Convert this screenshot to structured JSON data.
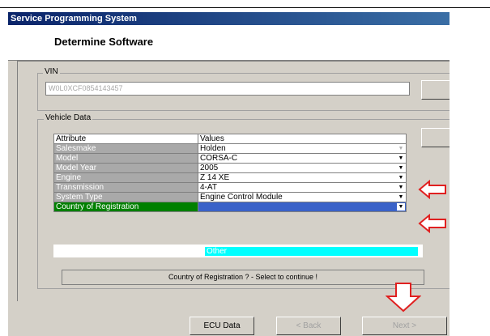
{
  "window": {
    "title": "Service Programming System"
  },
  "header": {
    "title": "Determine Software"
  },
  "vin": {
    "label": "VIN",
    "value": "W0L0XCF0854143457"
  },
  "vehicle_data": {
    "label": "Vehicle Data",
    "columns": [
      "Attribute",
      "Values"
    ],
    "rows": [
      {
        "attribute": "Salesmake",
        "value": "Holden",
        "dropdown_enabled": false
      },
      {
        "attribute": "Model",
        "value": "CORSA-C",
        "dropdown_enabled": true
      },
      {
        "attribute": "Model Year",
        "value": "2005",
        "dropdown_enabled": true
      },
      {
        "attribute": "Engine",
        "value": "Z 14 XE",
        "dropdown_enabled": true
      },
      {
        "attribute": "Transmission",
        "value": "4-AT",
        "dropdown_enabled": true
      },
      {
        "attribute": "System Type",
        "value": "Engine Control Module",
        "dropdown_enabled": true
      },
      {
        "attribute": "Country of Registration",
        "value": "",
        "dropdown_enabled": true,
        "selected": true
      }
    ],
    "open_option": "Other"
  },
  "status": {
    "text": "Country of Registration ? - Select to continue !"
  },
  "buttons": {
    "ecu_data": "ECU Data",
    "back": "< Back",
    "next": "Next >"
  },
  "colors": {
    "annotation_arrow": "#e02020",
    "selected_attribute": "#008000",
    "selected_value": "#3a62c8",
    "option_highlight": "#00ffff"
  }
}
